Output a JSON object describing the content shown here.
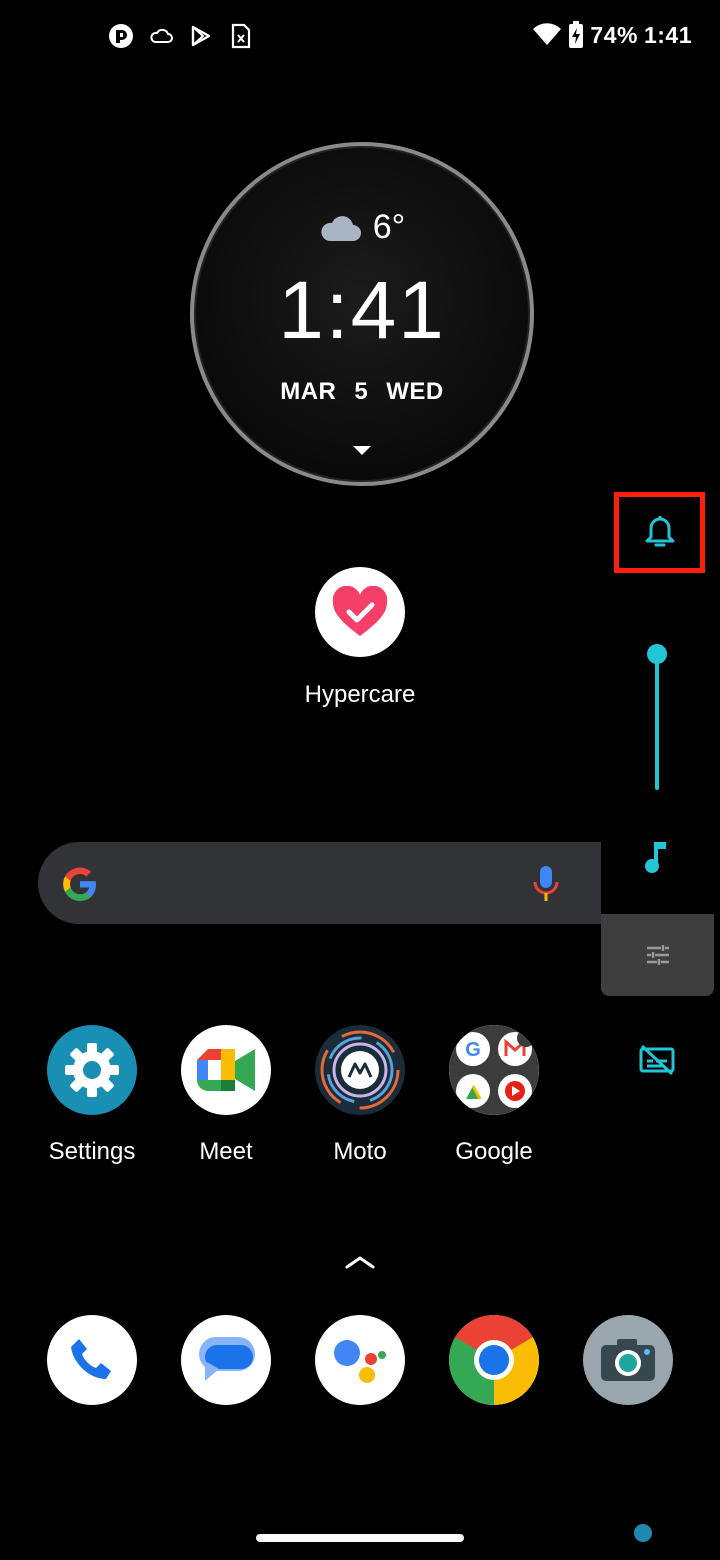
{
  "status_bar": {
    "battery": "74%",
    "time": "1:41",
    "left_icons": [
      "app-notification-icon",
      "cloud-icon",
      "play-store-icon",
      "sim-icon"
    ],
    "right_icons": [
      "wifi-icon",
      "battery-charging-icon"
    ]
  },
  "clock_widget": {
    "temperature": "6°",
    "weather_icon": "cloud-icon",
    "time": "1:41",
    "month": "MAR",
    "day": "5",
    "weekday": "WED"
  },
  "volume_panel": {
    "ring_icon": "bell-icon",
    "level": 1.0,
    "media_icon": "music-note-icon",
    "settings_icon": "sliders-icon",
    "captions_icon": "captions-off-icon",
    "accent_color": "#21c5d6",
    "highlight_color": "#ff1f0a"
  },
  "hypercare": {
    "label": "Hypercare"
  },
  "search": {
    "placeholder": ""
  },
  "apps_row": [
    {
      "label": "Settings"
    },
    {
      "label": "Meet"
    },
    {
      "label": "Moto"
    },
    {
      "label": "Google"
    }
  ],
  "dock": [
    "Phone",
    "Messages",
    "Assistant",
    "Chrome",
    "Camera"
  ]
}
